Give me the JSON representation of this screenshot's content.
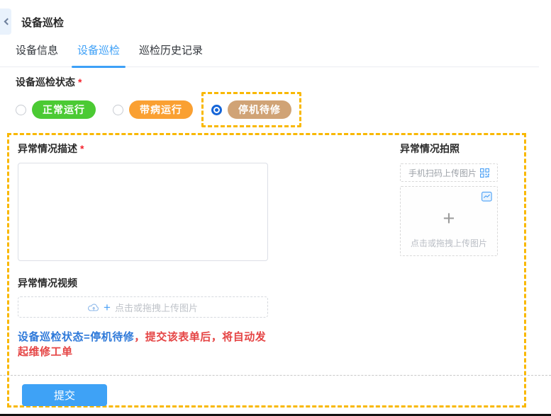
{
  "header": {
    "title": "设备巡检",
    "back_icon": "chevron-left"
  },
  "tabs": [
    {
      "label": "设备信息",
      "active": false
    },
    {
      "label": "设备巡检",
      "active": true
    },
    {
      "label": "巡检历史记录",
      "active": false
    }
  ],
  "form": {
    "required_mark": "*",
    "status": {
      "label": "设备巡检状态",
      "options": [
        {
          "label": "正常运行",
          "color": "#4bca33",
          "selected": false
        },
        {
          "label": "带病运行",
          "color": "#faa032",
          "selected": false
        },
        {
          "label": "停机待修",
          "color": "#d0a376",
          "selected": true,
          "highlighted": true
        }
      ]
    },
    "description": {
      "label": "异常情况描述",
      "value": "",
      "placeholder": ""
    },
    "photo": {
      "label": "异常情况拍照",
      "qr_button_label": "手机扫码上传图片",
      "qr_icon": "qr-code",
      "image_icon": "image",
      "plus": "+",
      "upload_hint": "点击或拖拽上传图片"
    },
    "video": {
      "label": "异常情况视频",
      "cloud_icon": "cloud-upload",
      "plus": "+",
      "upload_hint": "点击或拖拽上传图片"
    },
    "notice": {
      "blue_part": "设备巡检状态=停机待修",
      "red_part": "，提交该表单后，将自动发起维修工单"
    },
    "submit_label": "提交"
  },
  "colors": {
    "accent_blue": "#3da0f7",
    "submit_blue": "#3ea2f6",
    "highlight_dashed_yellow": "#f9b800",
    "badge_green": "#4bca33",
    "badge_orange": "#faa032",
    "badge_tan": "#d0a376",
    "required_red": "#f5222d",
    "notice_blue": "#2e79d9",
    "notice_red": "#e54545",
    "radio_selected_blue": "#1565d8"
  }
}
